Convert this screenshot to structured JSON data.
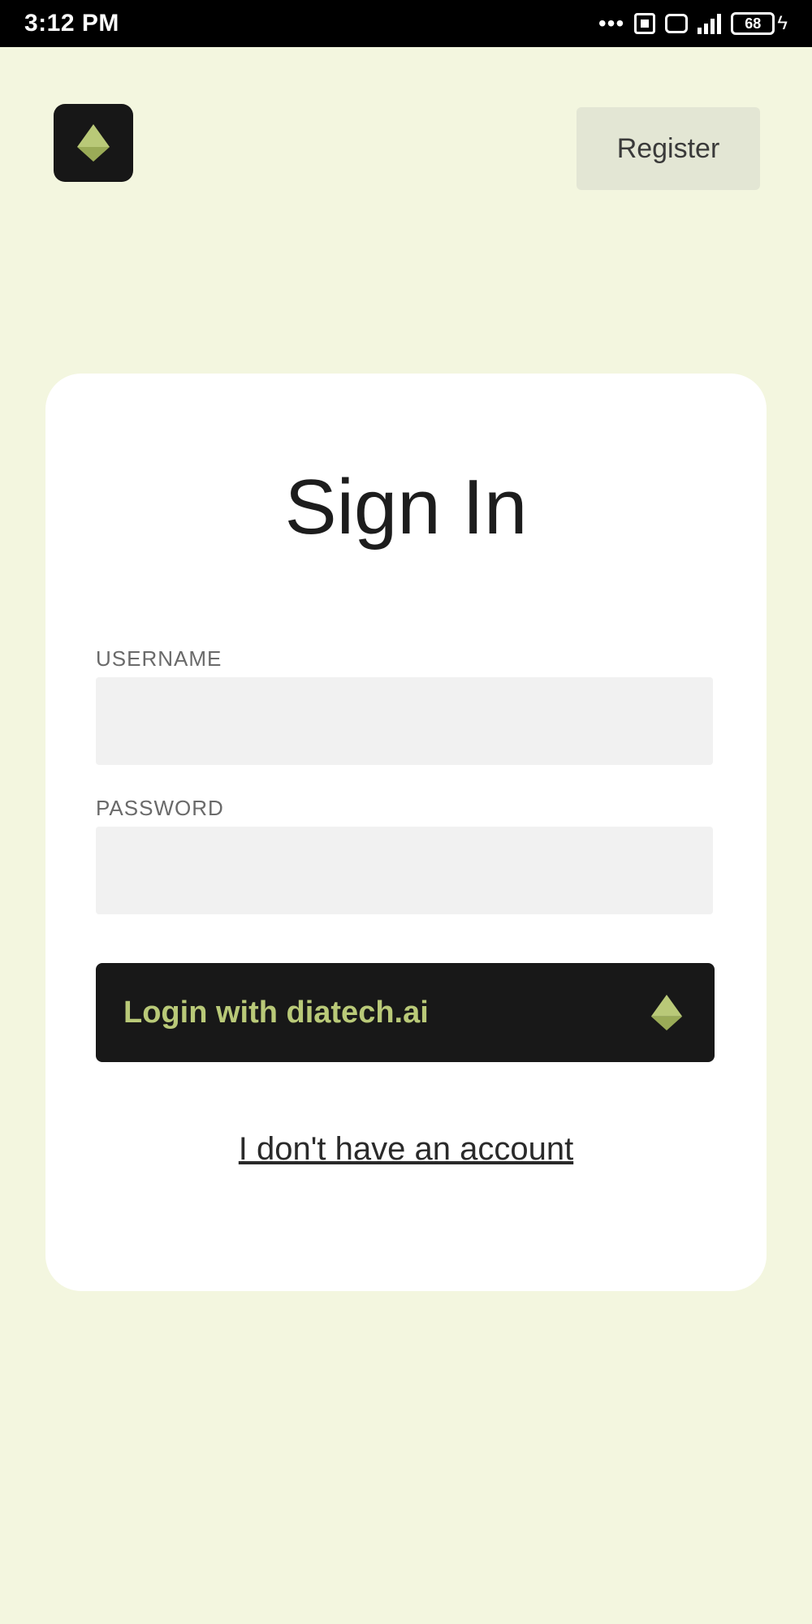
{
  "status_bar": {
    "time": "3:12 PM",
    "dots": "•••",
    "battery": "68"
  },
  "header": {
    "logo_icon": "diatech-diamond-icon",
    "register_label": "Register"
  },
  "card": {
    "title": "Sign In",
    "username_label": "USERNAME",
    "username_value": "",
    "password_label": "PASSWORD",
    "password_value": "",
    "login_button_label": "Login with diatech.ai",
    "no_account_link": "I don't have an account"
  },
  "colors": {
    "background": "#f3f6df",
    "card": "#ffffff",
    "button_dark": "#181818",
    "accent_green": "#b9c978",
    "register_bg": "#e3e6d4"
  }
}
